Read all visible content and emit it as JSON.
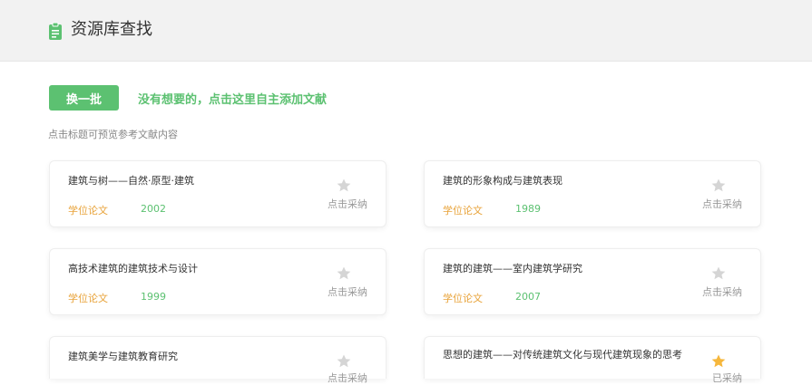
{
  "header": {
    "title": "资源库查找"
  },
  "actions": {
    "refresh_label": "换一批",
    "add_label": "没有想要的，点击这里自主添加文献",
    "hint": "点击标题可预览参考文献内容"
  },
  "colors": {
    "accent": "#5cc171",
    "type": "#e8a33a",
    "star_on": "#f6b73c",
    "star_off": "#d5d5d5"
  },
  "cards": [
    {
      "title": "建筑与树——自然·原型·建筑",
      "type": "学位论文",
      "year": "2002",
      "status": "点击采纳",
      "adopted": false
    },
    {
      "title": "建筑的形象构成与建筑表现",
      "type": "学位论文",
      "year": "1989",
      "status": "点击采纳",
      "adopted": false
    },
    {
      "title": "高技术建筑的建筑技术与设计",
      "type": "学位论文",
      "year": "1999",
      "status": "点击采纳",
      "adopted": false
    },
    {
      "title": "建筑的建筑——室内建筑学研究",
      "type": "学位论文",
      "year": "2007",
      "status": "点击采纳",
      "adopted": false
    },
    {
      "title": "建筑美学与建筑教育研究",
      "type": "",
      "year": "",
      "status": "点击采纳",
      "adopted": false
    },
    {
      "title": "思想的建筑——对传统建筑文化与现代建筑现象的思考",
      "type": "",
      "year": "",
      "status": "已采纳",
      "adopted": true
    }
  ]
}
